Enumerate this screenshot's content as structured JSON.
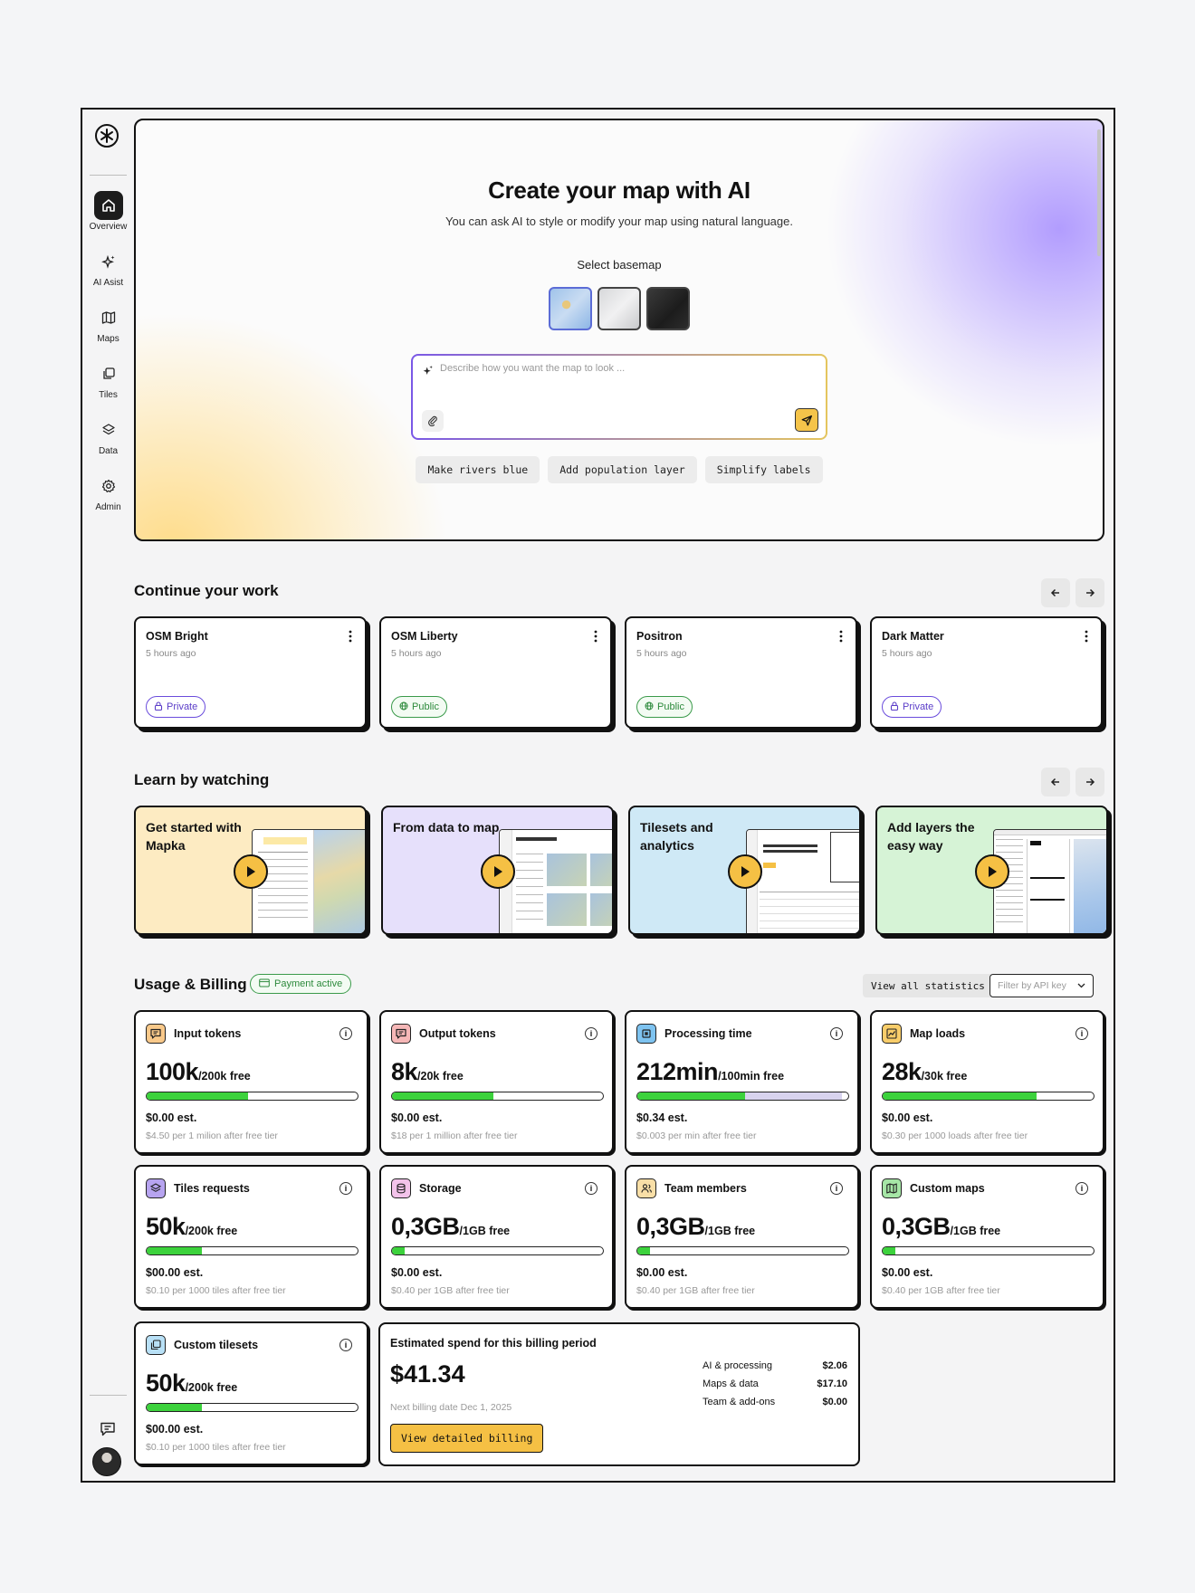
{
  "sidebar": {
    "logo": "mapka-logo",
    "items": [
      {
        "label": "Overview",
        "icon": "home-icon"
      },
      {
        "label": "AI Asist",
        "icon": "sparkle-icon"
      },
      {
        "label": "Maps",
        "icon": "map-icon"
      },
      {
        "label": "Tiles",
        "icon": "tiles-icon"
      },
      {
        "label": "Data",
        "icon": "layers-icon"
      },
      {
        "label": "Admin",
        "icon": "gear-icon"
      }
    ]
  },
  "hero": {
    "title": "Create your map with AI",
    "subtitle": "You can ask AI to style or modify your map using natural language.",
    "basemap_label": "Select basemap",
    "prompt_placeholder": "Describe how you want the map to look ...",
    "chips": [
      "Make rivers blue",
      "Add population layer",
      "Simplify labels"
    ]
  },
  "continue": {
    "title": "Continue your work",
    "cards": [
      {
        "title": "OSM Bright",
        "time": "5 hours ago",
        "visibility": "Private"
      },
      {
        "title": "OSM Liberty",
        "time": "5 hours ago",
        "visibility": "Public"
      },
      {
        "title": "Positron",
        "time": "5 hours ago",
        "visibility": "Public"
      },
      {
        "title": "Dark Matter",
        "time": "5 hours ago",
        "visibility": "Private"
      }
    ]
  },
  "learn": {
    "title": "Learn by watching",
    "videos": [
      {
        "title": "Get started with Mapka",
        "bg": "#fdebc2"
      },
      {
        "title": "From data to map",
        "bg": "#e6e0fb"
      },
      {
        "title": "Tilesets and analytics",
        "bg": "#cfe9f6"
      },
      {
        "title": "Add layers the easy way",
        "bg": "#d6f3d6"
      }
    ]
  },
  "billing": {
    "title": "Usage & Billing",
    "status": "Payment active",
    "view_all": "View all statistics",
    "filter_placeholder": "Filter by API key",
    "cards": [
      {
        "title": "Input tokens",
        "value": "100k",
        "free": "/200k free",
        "fill": 0.48,
        "est": "$0.00 est.",
        "note": "$4.50 per 1 milion after free tier",
        "icon": "chat-icon",
        "icon_bg": "#f9c98a"
      },
      {
        "title": "Output tokens",
        "value": "8k",
        "free": "/20k free",
        "fill": 0.48,
        "est": "$0.00 est.",
        "note": "$18 per 1 million after free tier",
        "icon": "chat-icon",
        "icon_bg": "#f6b7b7"
      },
      {
        "title": "Processing time",
        "value": "212min",
        "free": "/100min free",
        "fill": 0.51,
        "over": 0.97,
        "est": "$0.34 est.",
        "note": "$0.003 per min after free tier",
        "icon": "cpu-icon",
        "icon_bg": "#7ec3f0"
      },
      {
        "title": "Map loads",
        "value": "28k",
        "free": "/30k free",
        "fill": 0.73,
        "est": "$0.00 est.",
        "note": "$0.30 per 1000 loads after free tier",
        "icon": "chart-icon",
        "icon_bg": "#f8cd6a"
      },
      {
        "title": "Tiles requests",
        "value": "50k",
        "free": "/200k free",
        "fill": 0.26,
        "est": "$00.00 est.",
        "note": "$0.10 per 1000 tiles after free tier",
        "icon": "layers-icon",
        "icon_bg": "#b7a4f0"
      },
      {
        "title": "Storage",
        "value": "0,3GB",
        "free": "/1GB free",
        "fill": 0.06,
        "est": "$0.00 est.",
        "note": "$0.40 per 1GB after free tier",
        "icon": "database-icon",
        "icon_bg": "#f3c3ea"
      },
      {
        "title": "Team members",
        "value": "0,3GB",
        "free": "/1GB free",
        "fill": 0.06,
        "est": "$0.00 est.",
        "note": "$0.40 per 1GB after free tier",
        "icon": "users-icon",
        "icon_bg": "#f9dfa7"
      },
      {
        "title": "Custom maps",
        "value": "0,3GB",
        "free": "/1GB free",
        "fill": 0.06,
        "est": "$0.00 est.",
        "note": "$0.40 per 1GB after free tier",
        "icon": "map-icon",
        "icon_bg": "#a6e6a6"
      },
      {
        "title": "Custom tilesets",
        "value": "50k",
        "free": "/200k free",
        "fill": 0.26,
        "est": "$00.00 est.",
        "note": "$0.10 per 1000 tiles after free tier",
        "icon": "tiles-icon",
        "icon_bg": "#b8e0f6"
      }
    ],
    "spend": {
      "title": "Estimated spend for this billing period",
      "amount": "$41.34",
      "next": "Next billing date Dec 1, 2025",
      "button": "View detailed billing",
      "rows": [
        {
          "label": "AI & processing",
          "value": "$2.06"
        },
        {
          "label": "Maps & data",
          "value": "$17.10"
        },
        {
          "label": "Team & add-ons",
          "value": "$0.00"
        }
      ]
    }
  },
  "colors": {
    "accent_yellow": "#f5c044",
    "green_fill": "#3cd23c",
    "private": "#5a3cc8",
    "public": "#2d8a3c"
  }
}
